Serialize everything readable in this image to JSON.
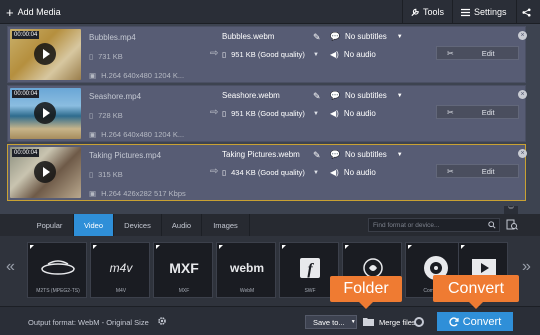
{
  "toolbar": {
    "add_media_label": "Add Media",
    "tools_label": "Tools",
    "settings_label": "Settings"
  },
  "files": [
    {
      "duration": "00:00:04",
      "source_name": "Bubbles.mp4",
      "source_size": "731 KB",
      "source_info": "H.264 640x480 1204 K...",
      "output_name": "Bubbles.webm",
      "output_size": "951 KB (Good quality)",
      "subtitles": "No subtitles",
      "audio": "No audio",
      "edit_label": "Edit",
      "selected": false
    },
    {
      "duration": "00:00:04",
      "source_name": "Seashore.mp4",
      "source_size": "728 KB",
      "source_info": "H.264 640x480 1204 K...",
      "output_name": "Seashore.webm",
      "output_size": "951 KB (Good quality)",
      "subtitles": "No subtitles",
      "audio": "No audio",
      "edit_label": "Edit",
      "selected": false
    },
    {
      "duration": "00:00:04",
      "source_name": "Taking Pictures.mp4",
      "source_size": "315 KB",
      "source_info": "H.264 426x282 517 Kbps",
      "output_name": "Taking Pictures.webm",
      "output_size": "434 KB (Good quality)",
      "subtitles": "No subtitles",
      "audio": "No audio",
      "edit_label": "Edit",
      "selected": true
    }
  ],
  "tabs": [
    "Popular",
    "Video",
    "Devices",
    "Audio",
    "Images"
  ],
  "active_tab": "Video",
  "search": {
    "placeholder": "Find format or device..."
  },
  "formats": [
    {
      "logo": "blu-ray-logo",
      "caption": "M2TS (MPEG2-TS)"
    },
    {
      "logo": "m4v",
      "caption": "M4V"
    },
    {
      "logo": "MXF",
      "caption": "MXF"
    },
    {
      "logo": "webm",
      "caption": "WebM"
    },
    {
      "logo": "flash-logo",
      "caption": "SWF"
    },
    {
      "logo": "quicktime-logo",
      "caption": ""
    },
    {
      "logo": "disc-logo",
      "caption": "Compatible"
    },
    {
      "logo": "film-logo",
      "caption": ""
    }
  ],
  "bottom": {
    "output_format_label": "Output format: WebM - Original Size",
    "save_to_label": "Save to...",
    "merge_label": "Merge files",
    "convert_label": "Convert"
  },
  "callouts": {
    "folder": "Folder",
    "convert": "Convert"
  },
  "colors": {
    "accent": "#2f8fd8",
    "callout": "#ef7b32",
    "selection": "#c9a233"
  }
}
